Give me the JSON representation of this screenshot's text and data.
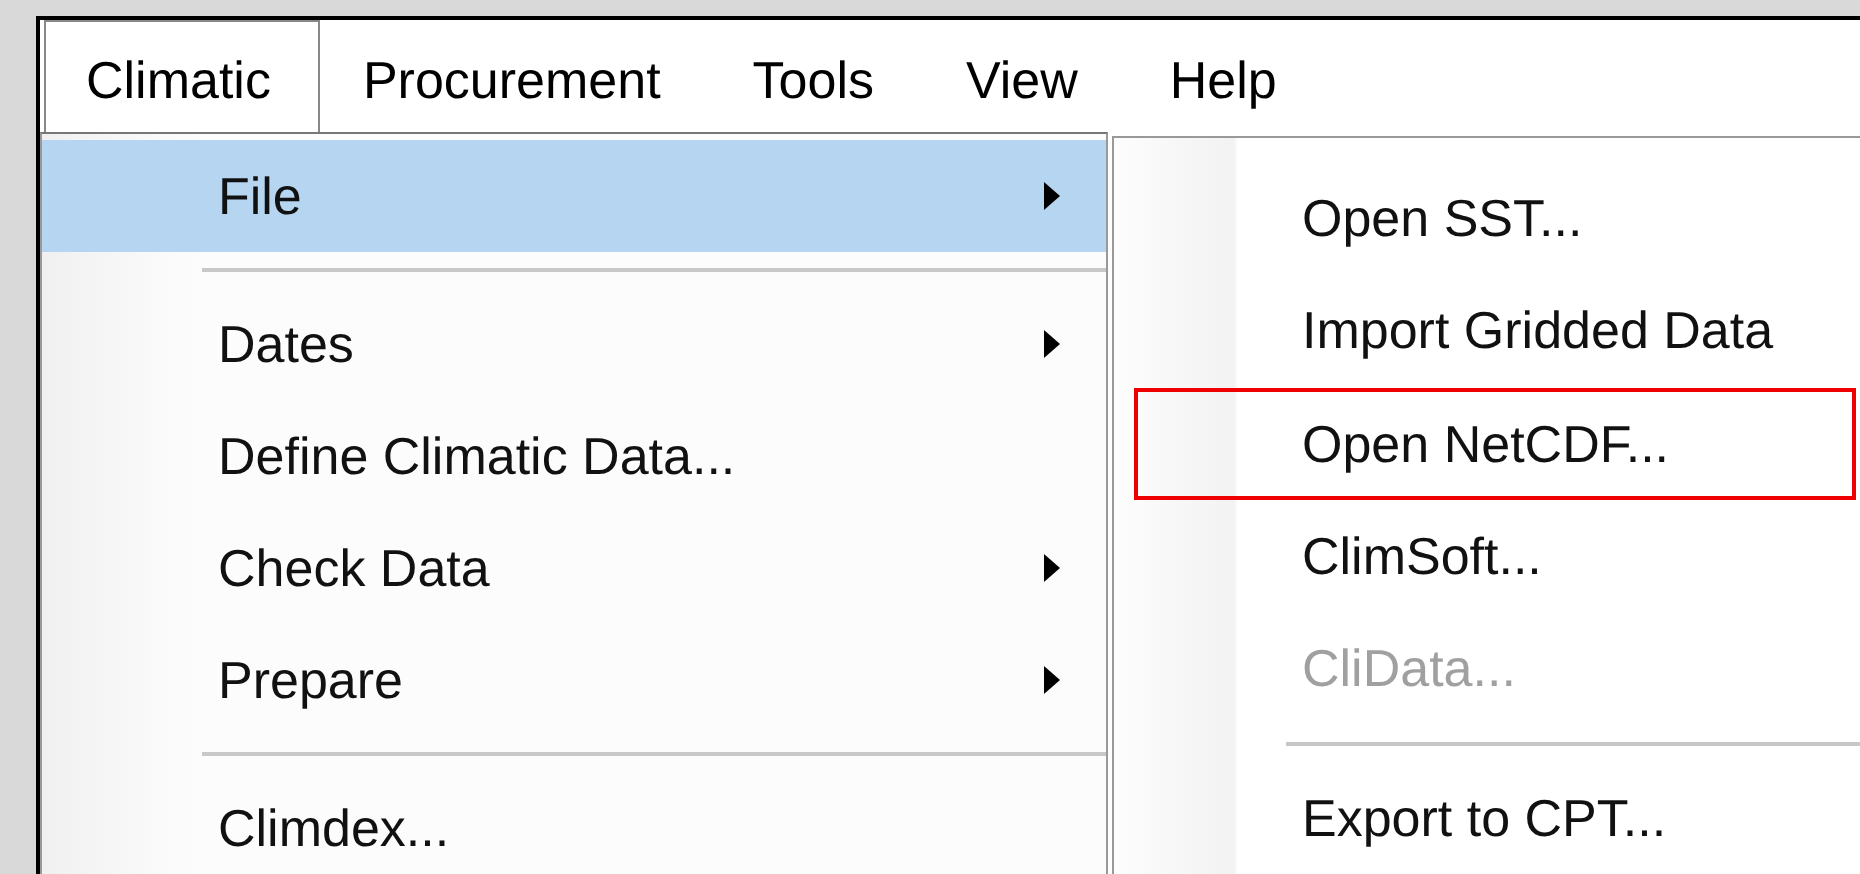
{
  "menu_bar": [
    {
      "label": "Climatic",
      "selected": true
    },
    {
      "label": "Procurement",
      "selected": false
    },
    {
      "label": "Tools",
      "selected": false
    },
    {
      "label": "View",
      "selected": false
    },
    {
      "label": "Help",
      "selected": false
    }
  ],
  "dropdown": {
    "items": [
      {
        "kind": "item",
        "label": "File",
        "submenu": true,
        "selected": true
      },
      {
        "kind": "separator"
      },
      {
        "kind": "item",
        "label": "Dates",
        "submenu": true,
        "selected": false
      },
      {
        "kind": "item",
        "label": "Define Climatic Data...",
        "submenu": false,
        "selected": false
      },
      {
        "kind": "item",
        "label": "Check Data",
        "submenu": true,
        "selected": false
      },
      {
        "kind": "item",
        "label": "Prepare",
        "submenu": true,
        "selected": false
      },
      {
        "kind": "separator"
      },
      {
        "kind": "item",
        "label": "Climdex...",
        "submenu": false,
        "selected": false
      }
    ]
  },
  "submenu": {
    "items": [
      {
        "kind": "item",
        "label": "Open SST...",
        "disabled": false,
        "highlighted": false
      },
      {
        "kind": "item",
        "label": "Import Gridded Data",
        "disabled": false,
        "highlighted": false
      },
      {
        "kind": "item",
        "label": "Open NetCDF...",
        "disabled": false,
        "highlighted": true
      },
      {
        "kind": "item",
        "label": "ClimSoft...",
        "disabled": false,
        "highlighted": false
      },
      {
        "kind": "item",
        "label": "CliData...",
        "disabled": true,
        "highlighted": false
      },
      {
        "kind": "separator"
      },
      {
        "kind": "item",
        "label": "Export to CPT...",
        "disabled": false,
        "highlighted": false
      }
    ]
  }
}
